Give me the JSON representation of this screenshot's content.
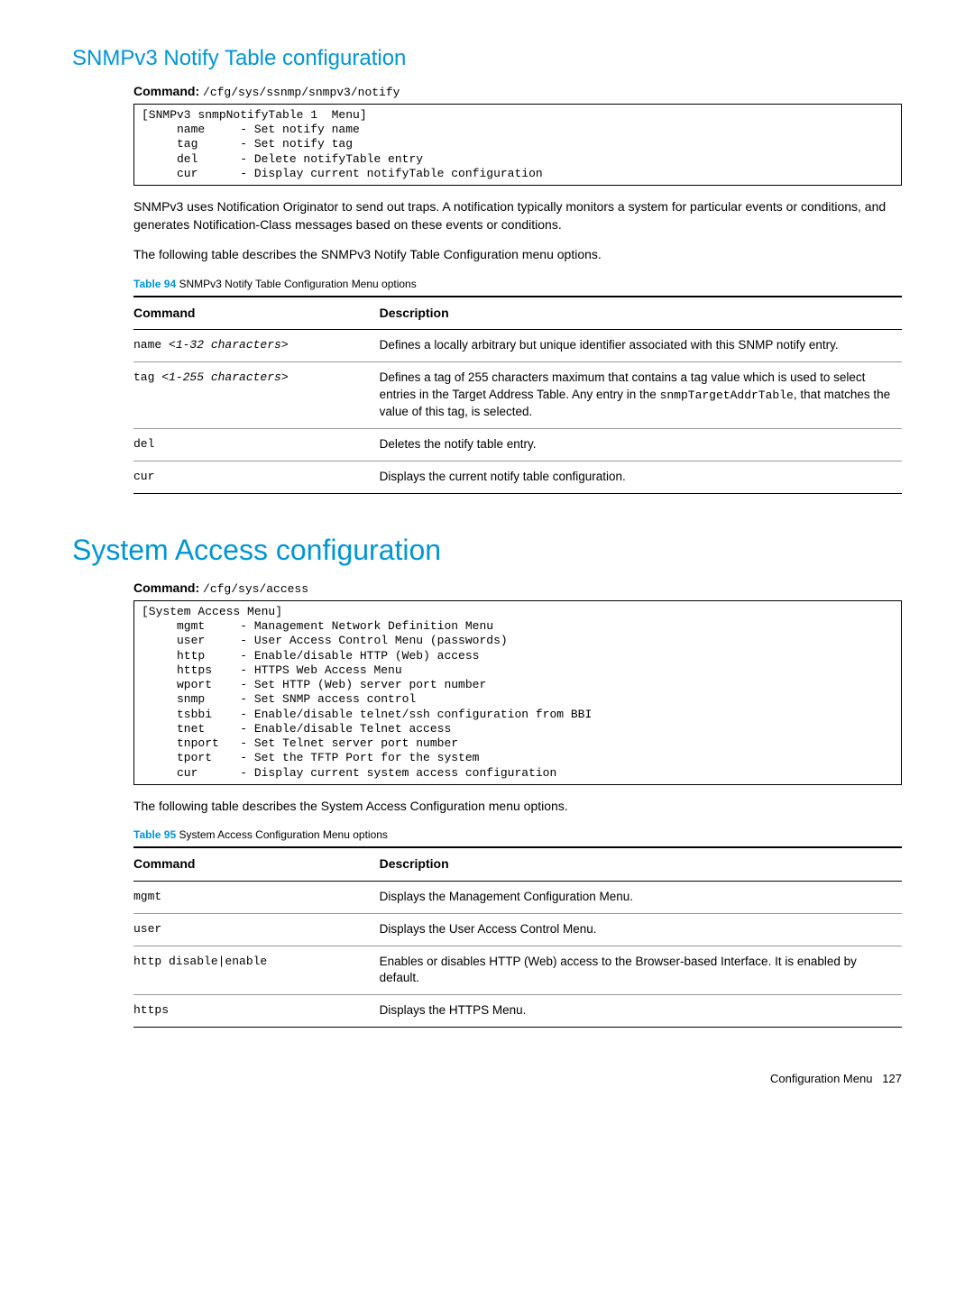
{
  "section1": {
    "heading": "SNMPv3 Notify Table configuration",
    "cmd_label": "Command:",
    "cmd_path": "/cfg/sys/ssnmp/snmpv3/notify",
    "codebox": "[SNMPv3 snmpNotifyTable 1  Menu]\n     name     - Set notify name\n     tag      - Set notify tag\n     del      - Delete notifyTable entry\n     cur      - Display current notifyTable configuration",
    "para1": "SNMPv3 uses Notification Originator to send out traps. A notification typically monitors a system for particular events or conditions, and generates Notification-Class messages based on these events or conditions.",
    "para2": "The following table describes the SNMPv3 Notify Table Configuration menu options.",
    "table_num": "Table 94",
    "table_title": "SNMPv3 Notify Table Configuration Menu options",
    "th_cmd": "Command",
    "th_desc": "Description",
    "rows": [
      {
        "cmd_pre": "name ",
        "cmd_arg": "<1-32 characters>",
        "desc": "Defines a locally arbitrary but unique identifier associated with this SNMP notify entry."
      },
      {
        "cmd_pre": "tag ",
        "cmd_arg": "<1-255 characters>",
        "desc_pre": "Defines a tag of 255 characters maximum that contains a tag value which is used to select entries in the Target Address Table. Any entry in the ",
        "desc_code": "snmpTargetAddrTable",
        "desc_post": ", that matches the value of this tag, is selected."
      },
      {
        "cmd_pre": "del",
        "cmd_arg": "",
        "desc": "Deletes the notify table entry."
      },
      {
        "cmd_pre": "cur",
        "cmd_arg": "",
        "desc": "Displays the current notify table configuration."
      }
    ]
  },
  "section2": {
    "heading": "System Access configuration",
    "cmd_label": "Command:",
    "cmd_path": "/cfg/sys/access",
    "codebox": "[System Access Menu]\n     mgmt     - Management Network Definition Menu\n     user     - User Access Control Menu (passwords)\n     http     - Enable/disable HTTP (Web) access\n     https    - HTTPS Web Access Menu\n     wport    - Set HTTP (Web) server port number\n     snmp     - Set SNMP access control\n     tsbbi    - Enable/disable telnet/ssh configuration from BBI\n     tnet     - Enable/disable Telnet access\n     tnport   - Set Telnet server port number\n     tport    - Set the TFTP Port for the system\n     cur      - Display current system access configuration",
    "para1": "The following table describes the System Access Configuration menu options.",
    "table_num": "Table 95",
    "table_title": "System Access Configuration Menu options",
    "th_cmd": "Command",
    "th_desc": "Description",
    "rows": [
      {
        "cmd": "mgmt",
        "desc": "Displays the Management Configuration Menu."
      },
      {
        "cmd": "user",
        "desc": "Displays the User Access Control Menu."
      },
      {
        "cmd": "http disable|enable",
        "desc": "Enables or disables HTTP (Web) access to the Browser-based Interface. It is enabled by default."
      },
      {
        "cmd": "https",
        "desc": "Displays the HTTPS Menu."
      }
    ]
  },
  "footer": {
    "label": "Configuration Menu",
    "page": "127"
  }
}
